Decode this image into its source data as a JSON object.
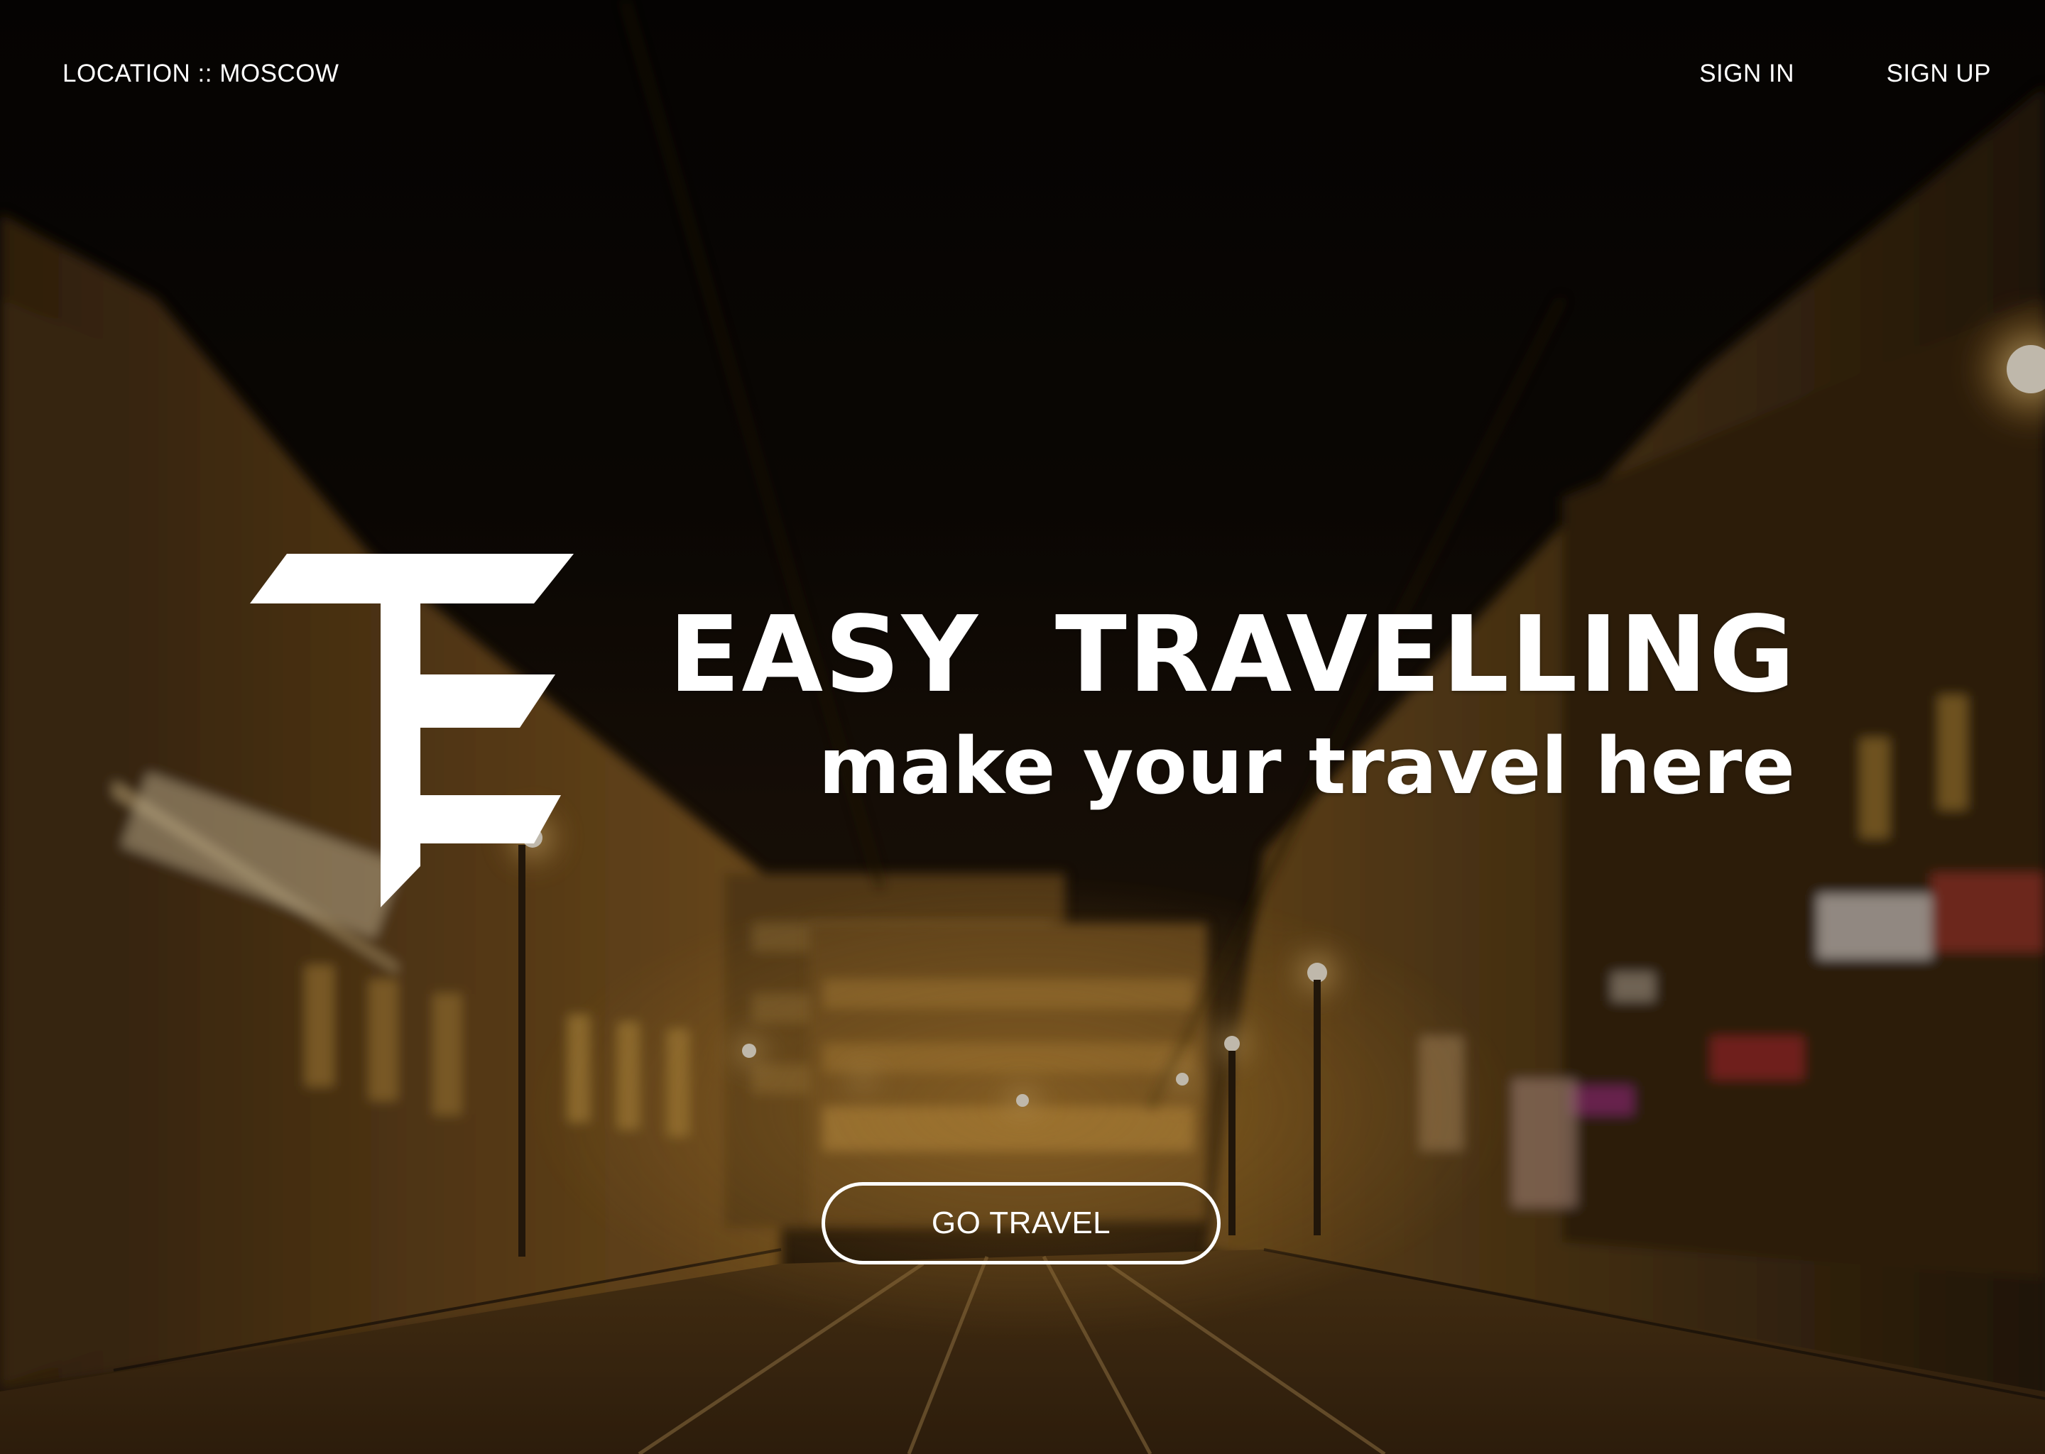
{
  "header": {
    "location_label": "LOCATION :: MOSCOW",
    "sign_in_label": "SIGN IN",
    "sign_up_label": "SIGN UP"
  },
  "hero": {
    "title": "EASY  TRAVELLING",
    "subtitle": "make your travel here",
    "cta_label": "GO TRAVEL",
    "logo_icon": "te-monogram-logo",
    "background": "night-city-street-photo"
  },
  "colors": {
    "text": "#ffffff",
    "background_dark": "#0a0704",
    "street_glow": "#c98a2c"
  }
}
